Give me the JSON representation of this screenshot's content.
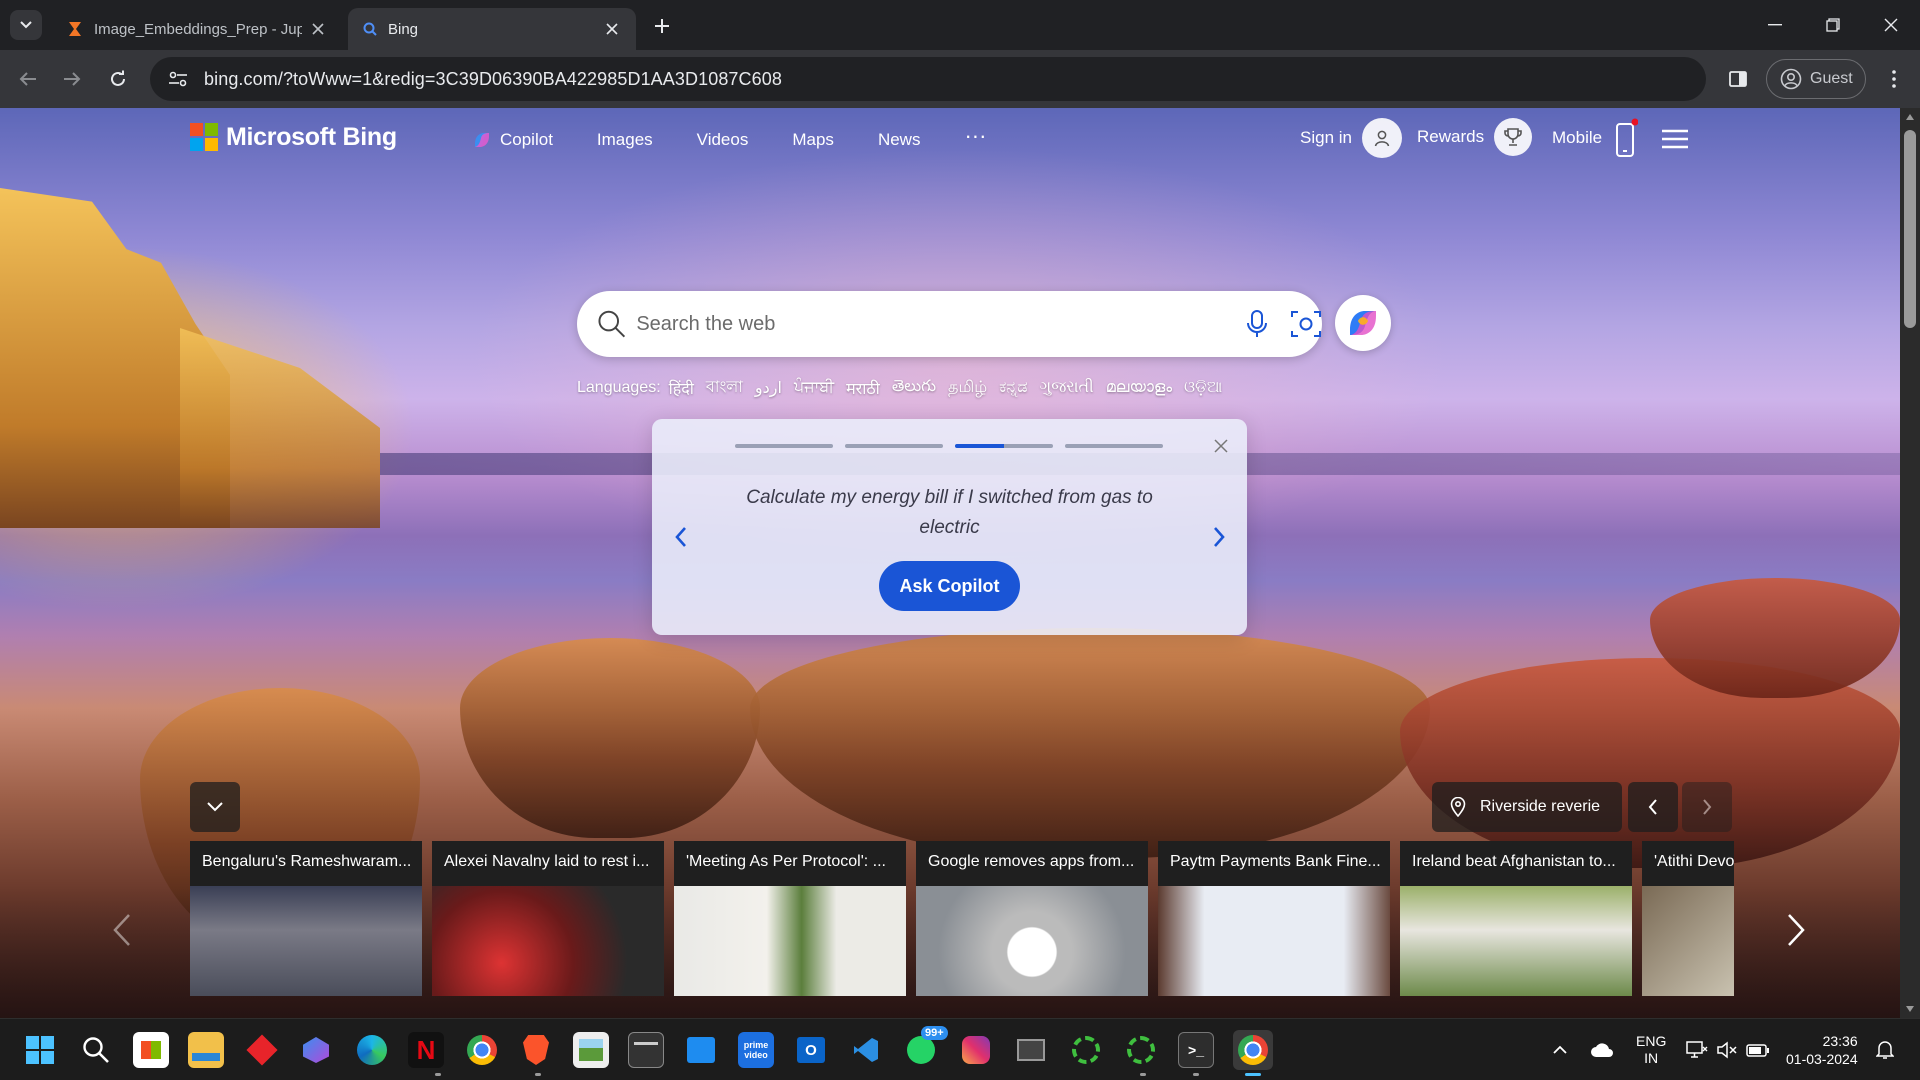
{
  "tabs": [
    {
      "title": "Image_Embeddings_Prep - Jupyter",
      "icon": "jupyter-icon"
    },
    {
      "title": "Bing",
      "icon": "bing-search-icon"
    }
  ],
  "address_bar": {
    "url": "bing.com/?toWww=1&redig=3C39D06390BA422985D1AA3D1087C608"
  },
  "profile": {
    "label": "Guest"
  },
  "bing": {
    "logo_text": "Microsoft Bing",
    "nav": [
      "Copilot",
      "Images",
      "Videos",
      "Maps",
      "News"
    ],
    "more": "···",
    "sign_in": "Sign in",
    "rewards": "Rewards",
    "mobile": "Mobile",
    "search_placeholder": "Search the web",
    "languages_label": "Languages:",
    "languages": [
      "हिंदी",
      "বাংলা",
      "اردو",
      "ਪੰਜਾਬੀ",
      "मराठी",
      "తెలుగు",
      "தமிழ்",
      "ಕನ್ನಡ",
      "ગુજરાતી",
      "മലയാളം",
      "ଓଡ଼ିଆ"
    ],
    "copilot_card": {
      "prompt": "Calculate my energy bill if I switched from gas to electric",
      "button": "Ask Copilot",
      "active_step": 3,
      "step_count": 4,
      "active_step_progress": 0.5
    },
    "image_caption": "Riverside reverie",
    "news": [
      "Bengaluru's Rameshwaram...",
      "Alexei Navalny laid to rest i...",
      "'Meeting As Per Protocol': ...",
      "Google removes apps from...",
      "Paytm Payments Bank Fine...",
      "Ireland beat Afghanistan to...",
      "'Atithi Devo"
    ]
  },
  "taskbar": {
    "whatsapp_badge": "99+",
    "language": "ENG",
    "region": "IN",
    "time": "23:36",
    "date": "01-03-2024"
  },
  "colors": {
    "accent": "#1a55d6",
    "tab_active": "#35363a",
    "chrome_bg": "#202124"
  }
}
